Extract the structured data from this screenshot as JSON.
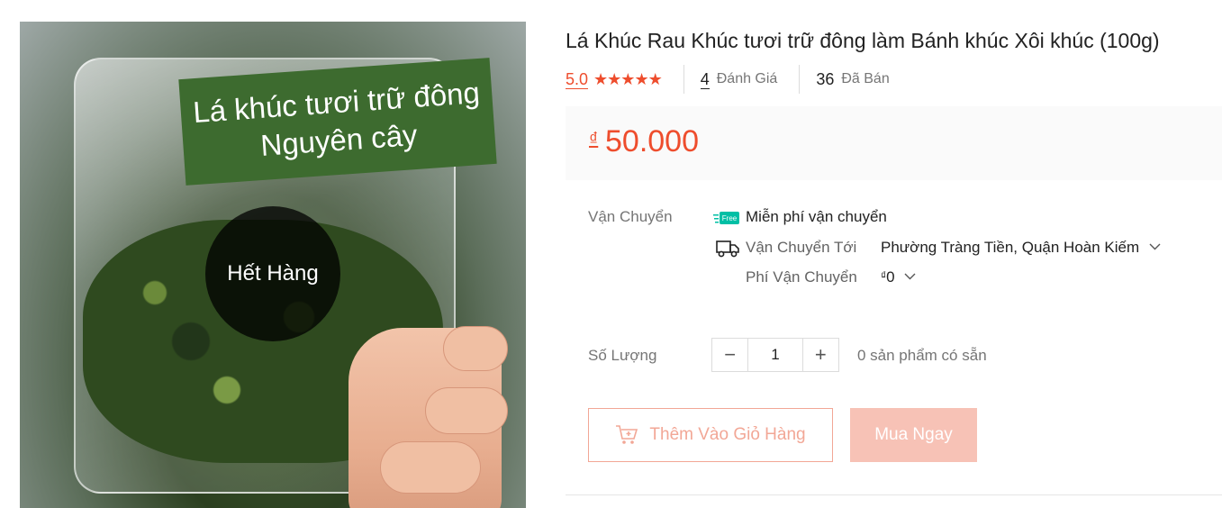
{
  "product": {
    "title": "Lá Khúc Rau Khúc tươi trữ đông làm Bánh khúc Xôi khúc (100g)",
    "image": {
      "sign_line1": "Lá khúc tươi trữ đông",
      "sign_line2": "Nguyên cây",
      "overlay": "Hết Hàng"
    }
  },
  "stats": {
    "rating": "5.0",
    "stars": "★★★★★",
    "reviews_count": "4",
    "reviews_label": "Đánh Giá",
    "sold_count": "36",
    "sold_label": "Đã Bán"
  },
  "price": {
    "currency": "₫",
    "amount": "50.000",
    "color": "#ee4d2d"
  },
  "shipping": {
    "label": "Vận Chuyển",
    "free_badge": "Free",
    "free_text": "Miễn phí vận chuyển",
    "ship_to_label": "Vận Chuyển Tới",
    "ship_to_value": "Phường Tràng Tiền, Quận Hoàn Kiếm",
    "fee_label": "Phí Vận Chuyển",
    "fee_currency": "₫",
    "fee_value": "0"
  },
  "quantity": {
    "label": "Số Lượng",
    "minus": "−",
    "value": "1",
    "plus": "+",
    "stock_text": "0 sản phẩm có sẵn"
  },
  "actions": {
    "add_to_cart": "Thêm Vào Giỏ Hàng",
    "buy_now": "Mua Ngay"
  }
}
